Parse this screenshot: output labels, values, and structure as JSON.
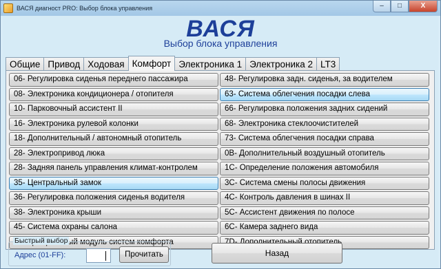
{
  "window": {
    "title": "ВАСЯ диагност PRO: Выбор блока управления",
    "buttons": {
      "minimize": "–",
      "maximize": "□",
      "close": "X"
    }
  },
  "header": {
    "app_title": "ВАСЯ",
    "subtitle": "Выбор блока управления"
  },
  "tabs": [
    {
      "label": "Общие"
    },
    {
      "label": "Привод"
    },
    {
      "label": "Ходовая"
    },
    {
      "label": "Комфорт",
      "active": true
    },
    {
      "label": "Электроника 1"
    },
    {
      "label": "Электроника 2"
    },
    {
      "label": "LT3"
    }
  ],
  "modules_left": [
    {
      "label": "06- Регулировка сиденья переднего пассажира"
    },
    {
      "label": "08- Электроника кондиционера / отопителя"
    },
    {
      "label": "10- Парковочный ассистент II"
    },
    {
      "label": "16- Электроника рулевой колонки"
    },
    {
      "label": "18- Дополнительный / автономный отопитель"
    },
    {
      "label": "28- Электропривод люка"
    },
    {
      "label": "28- Задняя панель управления климат-контролем"
    },
    {
      "label": "35- Центральный замок",
      "highlighted": true
    },
    {
      "label": "36- Регулировка положения сиденья водителя"
    },
    {
      "label": "38- Электроника крыши"
    },
    {
      "label": "45- Система охраны салона"
    },
    {
      "label": "46- Центральный модуль систем комфорта"
    }
  ],
  "modules_right": [
    {
      "label": "48- Регулировка задн. сиденья, за водителем"
    },
    {
      "label": "63- Система облегчения посадки слева",
      "highlighted": true
    },
    {
      "label": "66- Регулировка положения задних сидений"
    },
    {
      "label": "68- Электроника стеклоочистителей"
    },
    {
      "label": "73- Система облегчения посадки справа"
    },
    {
      "label": "0B- Дополнительный воздушный отопитель"
    },
    {
      "label": "1C- Определение положения автомобиля"
    },
    {
      "label": "3C- Система смены полосы движения"
    },
    {
      "label": "4C- Контроль давления в шинах II"
    },
    {
      "label": "5C- Ассистент движения по полосе"
    },
    {
      "label": "6C- Камера заднего вида"
    },
    {
      "label": "7D- Дополнительный отопитель"
    }
  ],
  "quick_select": {
    "legend": "Быстрый выбор",
    "address_label": "Адрес (01-FF):",
    "address_value": "",
    "read_button": "Прочитать"
  },
  "back_button": "Назад",
  "icons": [
    "app-icon"
  ],
  "colors": {
    "title_blue": "#1d3f99",
    "background": "#d6ebf6"
  }
}
